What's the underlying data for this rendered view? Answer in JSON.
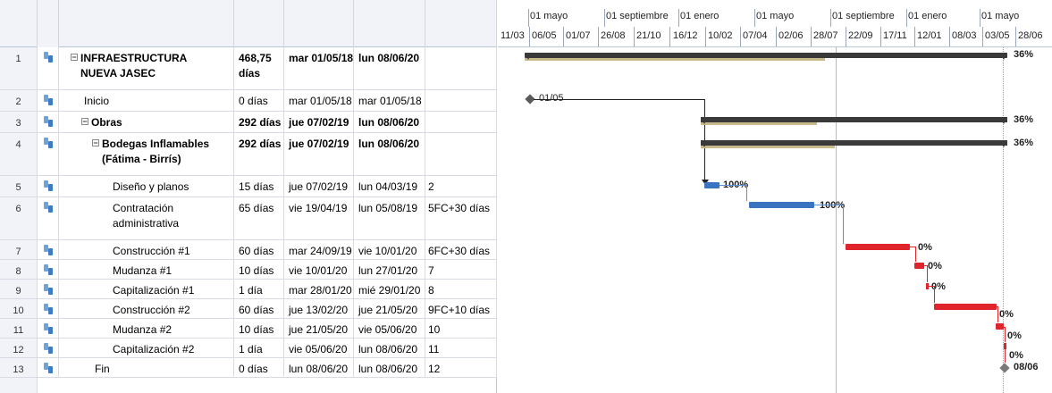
{
  "timescale": {
    "top": [
      "01 mayo",
      "01 septiembre",
      "01 enero",
      "01 mayo",
      "01 septiembre",
      "01 enero",
      "01 mayo"
    ],
    "bottom": [
      "11/03",
      "06/05",
      "01/07",
      "26/08",
      "21/10",
      "16/12",
      "10/02",
      "07/04",
      "02/06",
      "28/07",
      "22/09",
      "17/11",
      "12/01",
      "08/03",
      "03/05",
      "28/06"
    ]
  },
  "rows": [
    {
      "id": "1",
      "name": "INFRAESTRUCTURA NUEVA JASEC",
      "duration": "468,75 días",
      "start": "mar 01/05/18",
      "end": "lun 08/06/20",
      "pred": ""
    },
    {
      "id": "2",
      "name": "Inicio",
      "duration": "0 días",
      "start": "mar 01/05/18",
      "end": "mar 01/05/18",
      "pred": ""
    },
    {
      "id": "3",
      "name": "Obras",
      "duration": "292 días",
      "start": "jue 07/02/19",
      "end": "lun 08/06/20",
      "pred": ""
    },
    {
      "id": "4",
      "name": "Bodegas Inflamables (Fátima - Birrís)",
      "duration": "292 días",
      "start": "jue 07/02/19",
      "end": "lun 08/06/20",
      "pred": ""
    },
    {
      "id": "5",
      "name": "Diseño y planos",
      "duration": "15 días",
      "start": "jue 07/02/19",
      "end": "lun 04/03/19",
      "pred": "2"
    },
    {
      "id": "6",
      "name": "Contratación administrativa",
      "duration": "65 días",
      "start": "vie 19/04/19",
      "end": "lun 05/08/19",
      "pred": "5FC+30 días"
    },
    {
      "id": "7",
      "name": "Construcción #1",
      "duration": "60 días",
      "start": "mar 24/09/19",
      "end": "vie 10/01/20",
      "pred": "6FC+30 días"
    },
    {
      "id": "8",
      "name": "Mudanza #1",
      "duration": "10 días",
      "start": "vie 10/01/20",
      "end": "lun 27/01/20",
      "pred": "7"
    },
    {
      "id": "9",
      "name": "Capitalización #1",
      "duration": "1 día",
      "start": "mar 28/01/20",
      "end": "mié 29/01/20",
      "pred": "8"
    },
    {
      "id": "10",
      "name": "Construcción #2",
      "duration": "60 días",
      "start": "jue 13/02/20",
      "end": "jue 21/05/20",
      "pred": "9FC+10 días"
    },
    {
      "id": "11",
      "name": "Mudanza #2",
      "duration": "10 días",
      "start": "jue 21/05/20",
      "end": "vie 05/06/20",
      "pred": "10"
    },
    {
      "id": "12",
      "name": "Capitalización #2",
      "duration": "1 día",
      "start": "vie 05/06/20",
      "end": "lun 08/06/20",
      "pred": "11"
    },
    {
      "id": "13",
      "name": "Fin",
      "duration": "0 días",
      "start": "lun 08/06/20",
      "end": "lun 08/06/20",
      "pred": "12"
    }
  ],
  "gantt_labels": {
    "r1": "36%",
    "r2": "01/05",
    "r3": "36%",
    "r4": "36%",
    "r5": "100%",
    "r6": "100%",
    "r7": "0%",
    "r8": "0%",
    "r9": "0%",
    "r10": "0%",
    "r11": "0%",
    "r12": "0%",
    "r13": "08/06"
  },
  "colors": {
    "summary_bar": "#3a3a3a",
    "summary_progress": "#c8b98a",
    "task_done": "#3a74c0",
    "task_critical": "#e0242b",
    "status_line": "#f0b060",
    "link_blue": "#5b8fd8",
    "link_red": "#e0242b"
  }
}
